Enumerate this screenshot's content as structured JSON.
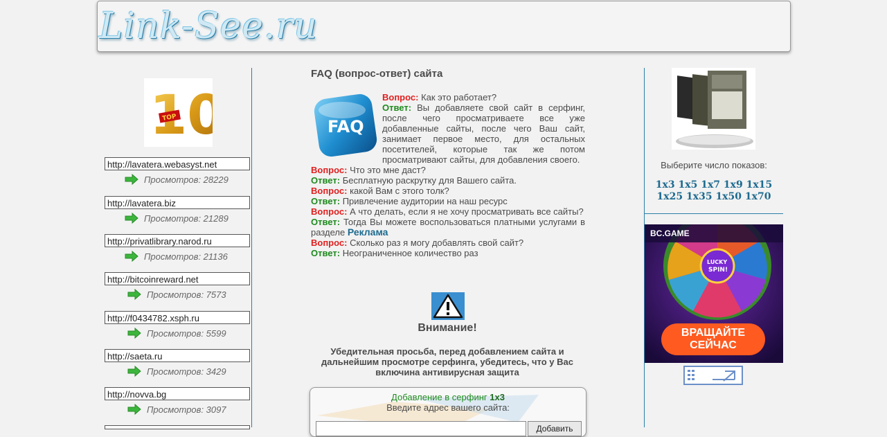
{
  "header": {
    "logo_text": "Link-See.ru"
  },
  "left": {
    "top_alt": "TOP 10",
    "links": [
      {
        "url": "http://lavatera.webasyst.net",
        "views": "Просмотров: 28229"
      },
      {
        "url": "http://lavatera.biz",
        "views": "Просмотров: 21289"
      },
      {
        "url": "http://privatlibrary.narod.ru",
        "views": "Просмотров: 21136"
      },
      {
        "url": "http://bitcoinreward.net",
        "views": "Просмотров: 7573"
      },
      {
        "url": "http://f0434782.xsph.ru",
        "views": "Просмотров: 5599"
      },
      {
        "url": "http://saeta.ru",
        "views": "Просмотров: 3429"
      },
      {
        "url": "http://novva.bg",
        "views": "Просмотров: 3097"
      }
    ]
  },
  "center": {
    "title": "FAQ (вопрос-ответ) сайта",
    "faq_img_text": "FAQ",
    "q_label": "Вопрос:",
    "a_label": "Ответ:",
    "items": [
      {
        "q": "Как это работает?",
        "a": "Вы добавляете свой сайт в серфинг, после чего просматриваете все уже добавленные сайты, после чего Ваш сайт, занимает первое место, для остальных посетителей, которые так же потом просматривают сайты, для добавления своего."
      },
      {
        "q": "Что это мне даст?",
        "a": "Бесплатную раскрутку для Вашего сайта."
      },
      {
        "q": "какой Вам с этого толк?",
        "a": "Привлечение аудитории на наш ресурс"
      },
      {
        "q": "А что делать, если я не хочу просматривать все сайты?",
        "a": "Тогда Вы можете воспользоваться платными услугами в разделе",
        "link": "Реклама"
      },
      {
        "q": "Сколько раз я могу добавлять свой сайт?",
        "a": "Неограниченное количество раз"
      }
    ],
    "warning_title": "Внимание!",
    "warning_text": "Убедительная просьба, перед добавлением сайта и дальнейшим просмотре серфинга, убедитесь, что у Вас включина антивирусная защита",
    "add_title": "Добавление в серфинг",
    "add_plan": "1х3",
    "add_sub": "Введите адрес вашего сайта:",
    "add_button": "Добавить"
  },
  "right": {
    "choose_text": "Выберите число показов:",
    "plans_row1": [
      "1х3",
      "1х5",
      "1х7",
      "1х9",
      "1х15"
    ],
    "plans_row2": [
      "1х25",
      "1х35",
      "1х50",
      "1х70"
    ],
    "banner_brand": "BC.GAME",
    "banner_center": "LUCKY SPIN!",
    "banner_cta_line1": "ВРАЩАЙТЕ",
    "banner_cta_line2": "СЕЙЧАС"
  },
  "colors": {
    "link_blue": "#1d6a8f",
    "question_red": "#e02020",
    "answer_green": "#1e8a1e",
    "divider": "#2a7fa6"
  }
}
